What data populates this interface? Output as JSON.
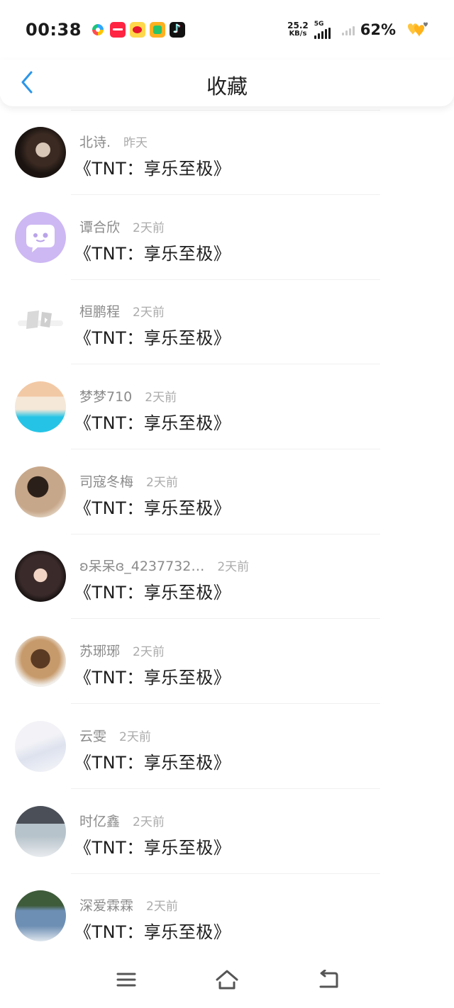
{
  "status_bar": {
    "time": "00:38",
    "app_icons": [
      "sync-app-icon",
      "xiaohongshu-app-icon",
      "weibo-app-icon",
      "video-app-icon",
      "tiktok-app-icon"
    ],
    "net_speed": "25.2",
    "net_speed_unit": "KB/s",
    "network_type": "5G",
    "battery": "62%"
  },
  "header": {
    "title": "收藏",
    "back_icon": "chevron-left-icon",
    "accent_color": "#2b95e9"
  },
  "favorites": [
    {
      "user": "北诗.",
      "time": "昨天",
      "title": "《TNT：享乐至极》"
    },
    {
      "user": "谭合欣",
      "time": "2天前",
      "title": "《TNT：享乐至极》"
    },
    {
      "user": "桓鹏程",
      "time": "2天前",
      "title": "《TNT：享乐至极》"
    },
    {
      "user": "梦梦710",
      "time": "2天前",
      "title": "《TNT：享乐至极》"
    },
    {
      "user": "司寇冬梅",
      "time": "2天前",
      "title": "《TNT：享乐至极》"
    },
    {
      "user": "ʚ呆呆ɞ_4237732…",
      "time": "2天前",
      "title": "《TNT：享乐至极》"
    },
    {
      "user": "苏琊琊",
      "time": "2天前",
      "title": "《TNT：享乐至极》"
    },
    {
      "user": "云雯",
      "time": "2天前",
      "title": "《TNT：享乐至极》"
    },
    {
      "user": "时亿鑫",
      "time": "2天前",
      "title": "《TNT：享乐至极》"
    },
    {
      "user": "深爱霖霖",
      "time": "2天前",
      "title": "《TNT：享乐至极》"
    }
  ],
  "nav_bar": {
    "icons": [
      "menu-icon",
      "home-icon",
      "back-icon"
    ]
  }
}
